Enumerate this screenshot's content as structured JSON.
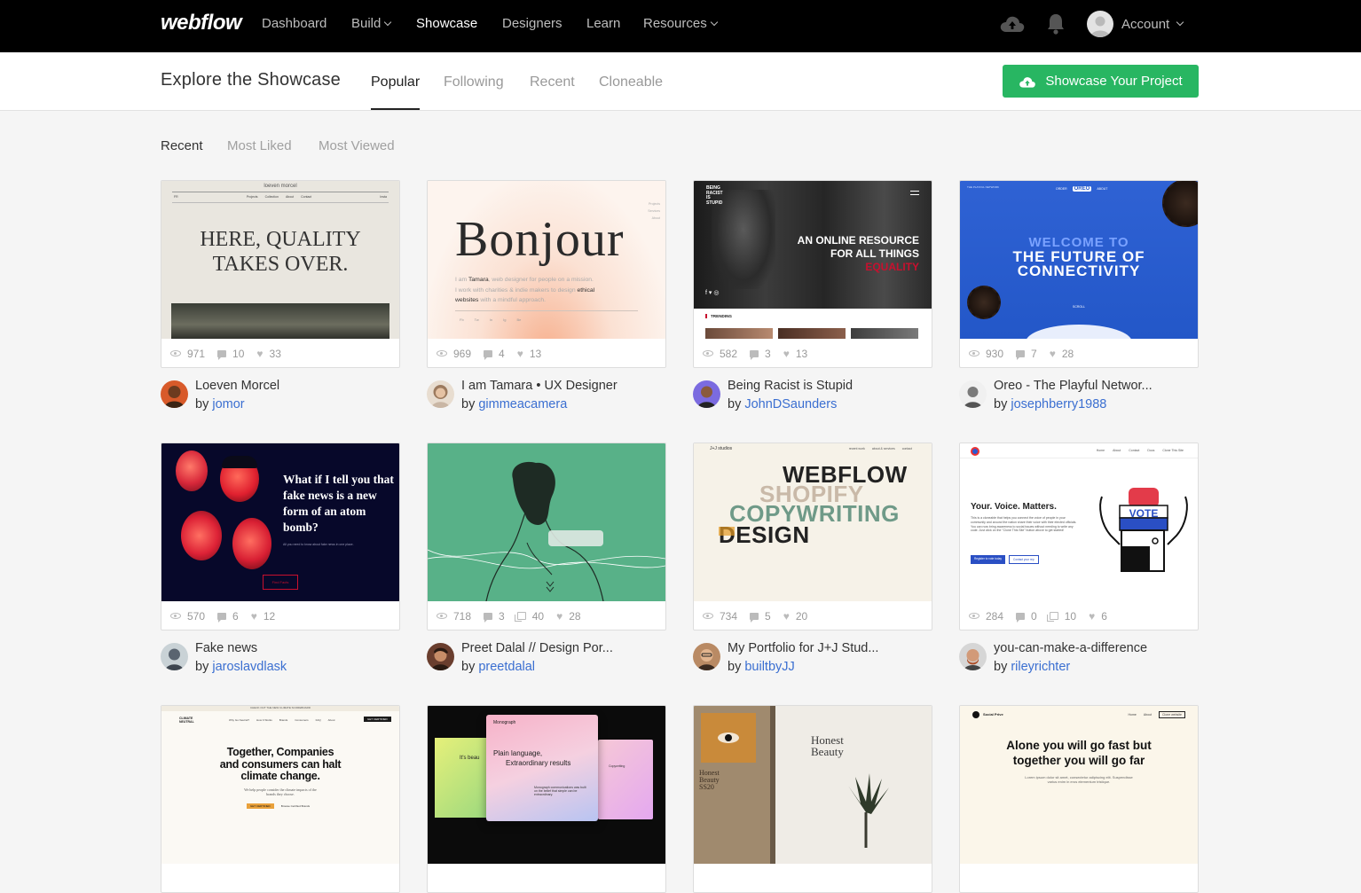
{
  "brand": "webflow",
  "nav": {
    "items": [
      {
        "label": "Dashboard",
        "dropdown": false
      },
      {
        "label": "Build",
        "dropdown": true
      },
      {
        "label": "Showcase",
        "dropdown": false,
        "active": true
      },
      {
        "label": "Designers",
        "dropdown": false
      },
      {
        "label": "Learn",
        "dropdown": false
      },
      {
        "label": "Resources",
        "dropdown": true
      }
    ],
    "account_label": "Account"
  },
  "subheader": {
    "title": "Explore the Showcase",
    "tabs": [
      "Popular",
      "Following",
      "Recent",
      "Cloneable"
    ],
    "active_tab": "Popular",
    "cta_label": "Showcase Your Project"
  },
  "filters": [
    "Recent",
    "Most Liked",
    "Most Viewed"
  ],
  "active_filter": "Recent",
  "colors": {
    "cta": "#28b662",
    "link": "#3b6fd1",
    "topbar": "#000000"
  },
  "cards": [
    {
      "title": "Loeven Morcel",
      "author": "jomor",
      "views": "971",
      "comments": "10",
      "likes": "33",
      "thumb": {
        "top": "loeven morcel",
        "nav": [
          "FR",
          "Projects",
          "Collection",
          "About",
          "Contact",
          "Insta"
        ],
        "headline1": "HERE, QUALITY",
        "headline2": "TAKES OVER."
      }
    },
    {
      "title": "I am Tamara • UX Designer",
      "author": "gimmeacamera",
      "views": "969",
      "comments": "4",
      "likes": "13",
      "thumb": {
        "headline": "Bonjour",
        "line1a": "I am ",
        "line1b": "Tamara",
        "line1c": ", web designer for people on a mission.",
        "line2a": "I work with charities & indie makers to design ",
        "line2b": "ethical",
        "line3a": "websites",
        "line3b": " with a mindful approach.",
        "side": [
          "Projects",
          "Services",
          "About"
        ],
        "social": [
          "Fb",
          "Tw",
          "In",
          "Ig",
          "Be"
        ]
      }
    },
    {
      "title": "Being Racist is Stupid",
      "author": "JohnDSaunders",
      "views": "582",
      "comments": "3",
      "likes": "13",
      "thumb": {
        "logo": "BEING RACIST IS STUPID",
        "headline1": "AN ONLINE RESOURCE",
        "headline2": "FOR ALL THINGS",
        "headline3": "EQUALITY",
        "trending": "TRENDING",
        "social": "f ▾ ◎"
      }
    },
    {
      "title": "Oreo - The Playful Networ...",
      "author": "josephberry1988",
      "views": "930",
      "comments": "7",
      "likes": "28",
      "thumb": {
        "brand": "OREO",
        "nav": [
          "ORDER",
          "ABOUT"
        ],
        "headline1": "WELCOME TO",
        "headline2": "THE FUTURE OF",
        "headline3": "CONNECTIVITY",
        "scroll": "SCROLL",
        "corner": "THE PLAYFUL NETWORK"
      }
    },
    {
      "title": "Fake news",
      "author": "jaroslavdlask",
      "views": "570",
      "comments": "6",
      "likes": "12",
      "thumb": {
        "headline": "What if I tell you that fake news is a new form of an atom bomb?",
        "sub": "All you need to know about fake news in one place.",
        "button": "Find Facts"
      }
    },
    {
      "title": "Preet Dalal // Design Por...",
      "author": "preetdalal",
      "views": "718",
      "comments": "3",
      "clones": "40",
      "likes": "28",
      "thumb": {}
    },
    {
      "title": "My Portfolio for J+J Stud...",
      "author": "builtbyJJ",
      "views": "734",
      "comments": "5",
      "likes": "20",
      "thumb": {
        "brand": "J+J studios",
        "nav": [
          "recent work",
          "about & services",
          "contact"
        ],
        "words": [
          "WEBFLOW",
          "SHOPIFY",
          "COPYWRITING",
          "DESIGN"
        ]
      }
    },
    {
      "title": "you-can-make-a-difference",
      "author": "rileyrichter",
      "views": "284",
      "comments": "0",
      "clones": "10",
      "likes": "6",
      "thumb": {
        "nav": [
          "Home",
          "About",
          "Contact",
          "Docs",
          "Clone This Site"
        ],
        "headline": "Your. Voice. Matters.",
        "body": "This is a cloneable that helps you connect the voice of people in your community and around the nation share their voice with their elected officials. You can now bring awareness to social issues without needing to write any code. Just click on the \"Clone This Site\" button above to get started!",
        "btn1": "Register to vote today",
        "btn2": "Contact your rep",
        "vote": "VOTE"
      }
    },
    {
      "title": "",
      "author": "",
      "thumb": {
        "banner": "CHECK OUT THE NEW CLIMATE SCOREBOARD",
        "logo": "CLIMATE NEUTRAL",
        "nav": [
          "Why Go Neutral?",
          "How It Works",
          "Brands",
          "Consumers",
          "FAQ",
          "About"
        ],
        "cta": "GET CERTIFIED",
        "headline": "Together, Companies and consumers can halt climate change.",
        "sub": "We help people consider the climate impacts of the brands they choose.",
        "btn1": "GET CERTIFIED",
        "btn2": "Browse Certified Brands"
      }
    },
    {
      "title": "",
      "author": "",
      "thumb": {
        "brand": "Monograph",
        "headline1": "Plain language,",
        "headline2": "Extraordinary results",
        "side": "It's beau",
        "right": "Copywriting",
        "body": "Monograph communications was built on the belief that simple can be extraordinary."
      }
    },
    {
      "title": "",
      "author": "",
      "thumb": {
        "brand1": "Honest",
        "brand2": "Beauty",
        "left1": "Honest",
        "left2": "Beauty",
        "left3": "SS20"
      }
    },
    {
      "title": "",
      "author": "",
      "thumb": {
        "brand": "Social Prive",
        "nav": [
          "Home",
          "About"
        ],
        "nav_btn": "Clone website",
        "headline1": "Alone you will go fast but",
        "headline2": "together you will go far",
        "body": "Lorem ipsum dolor sit amet, consectetur adipiscing elit. Suspendisse varius enim in eros elementum tristique."
      }
    }
  ]
}
